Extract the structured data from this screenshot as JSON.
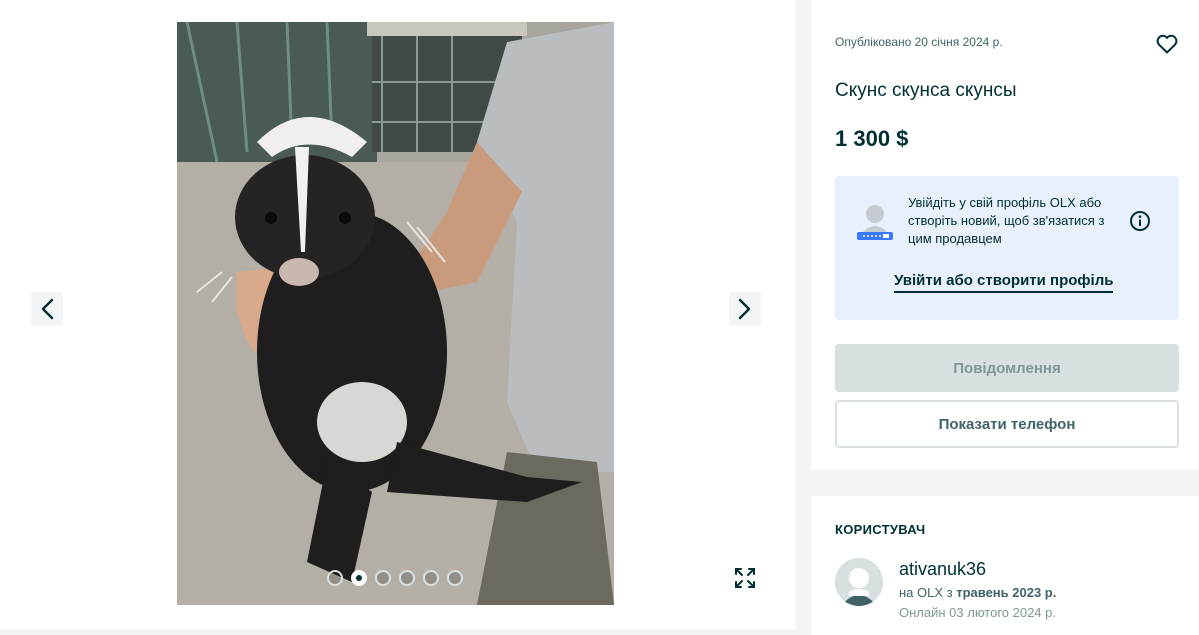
{
  "gallery": {
    "photo_alt": "photo",
    "total_images": 6,
    "active_index": 1,
    "icons": {
      "prev": "chevron-left-icon",
      "next": "chevron-right-icon",
      "expand": "expand-icon"
    }
  },
  "listing": {
    "posted": "Опубліковано 20 січня 2024 р.",
    "title": "Скунс скунса скунсы",
    "price": "1 300 $",
    "favorite_icon": "heart-icon"
  },
  "login_prompt": {
    "text": "Увійдіть у свій профіль OLX або створіть новий, щоб зв'язатися з цим продавцем",
    "link": "Увійти або створити профіль",
    "info_icon": "info-icon"
  },
  "actions": {
    "message": "Повідомлення",
    "show_phone": "Показати телефон"
  },
  "user": {
    "section_title": "КОРИСТУВАЧ",
    "name": "ativanuk36",
    "since_prefix": "на OLX з ",
    "since_date": "травень 2023 р.",
    "online": "Онлайн 03 лютого 2024 р."
  },
  "colors": {
    "primary": "#002f34",
    "login_bg": "#e8f0fb",
    "disabled_btn": "#d8dfe0",
    "page_bg": "#f2f4f5"
  }
}
